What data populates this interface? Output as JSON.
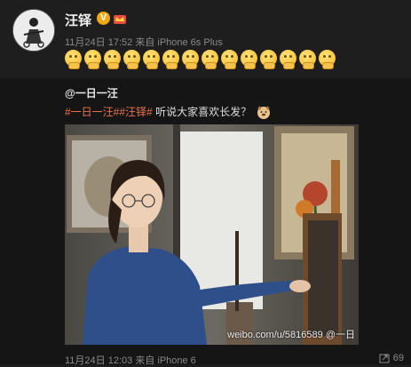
{
  "post": {
    "author": "汪铎",
    "verified_badge": "V",
    "timestamp": "11月24日 17:52",
    "source_prefix": "来自",
    "source": "iPhone 6s Plus",
    "emoji_icon": "praying-hands-emoji",
    "emoji_count": 14
  },
  "repost": {
    "author": "@一日一汪",
    "tag1": "#一日一汪#",
    "tag2": "#汪铎#",
    "text": "听说大家喜欢长发？",
    "image_watermark": "weibo.com/u/5816589",
    "image_watermark_partial": "@一日",
    "timestamp": "11月24日 12:03",
    "source_prefix": "来自",
    "source": "iPhone 6",
    "share_count": "69"
  },
  "colors": {
    "background": "#1c1c1c",
    "tag": "#eb7350",
    "meta": "#8a8a8a"
  }
}
